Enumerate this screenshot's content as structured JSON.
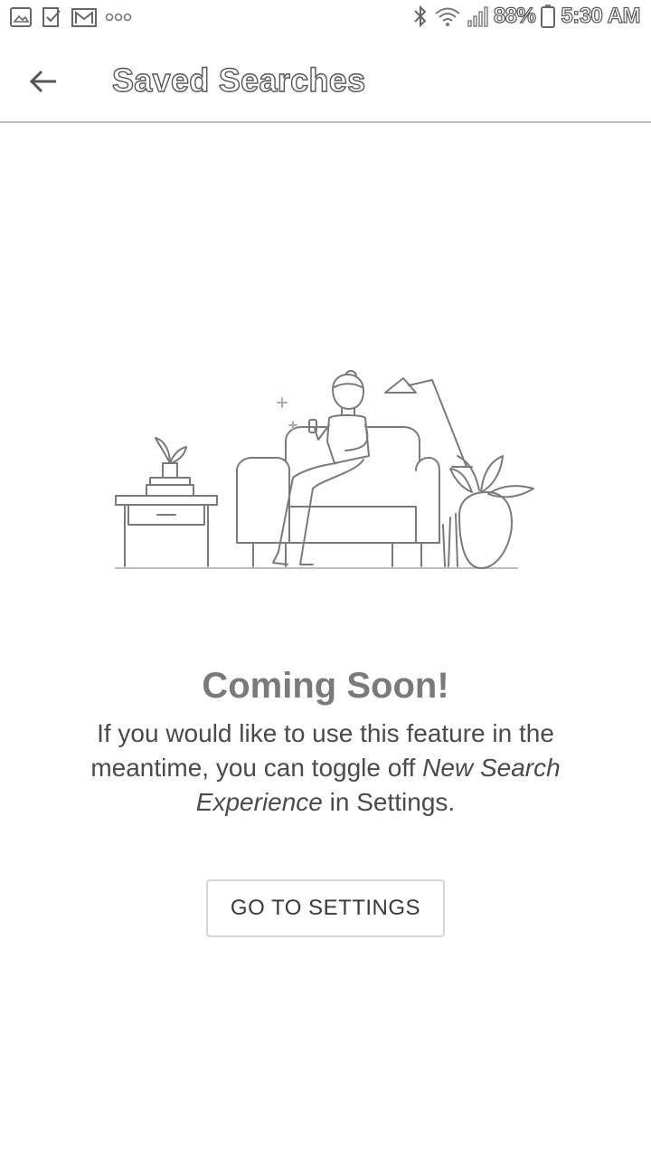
{
  "status_bar": {
    "battery": "88%",
    "time": "5:30 AM",
    "left_icons": [
      "photo-notification-icon",
      "task-notification-icon",
      "gmail-notification-icon",
      "more-notifications-icon"
    ],
    "right_icons": [
      "bluetooth-icon",
      "wifi-icon",
      "signal-icon",
      "battery-icon"
    ]
  },
  "app_bar": {
    "title": "Saved Searches",
    "back_icon": "arrow-left-icon"
  },
  "empty_state": {
    "heading": "Coming Soon!",
    "message_part1": "If you would like to use this feature in the meantime, you can toggle off ",
    "message_emphasis": "New Search Experience",
    "message_part2": " in Settings.",
    "button_label": "GO TO SETTINGS",
    "illustration": "person-on-couch-with-phone-illustration"
  }
}
